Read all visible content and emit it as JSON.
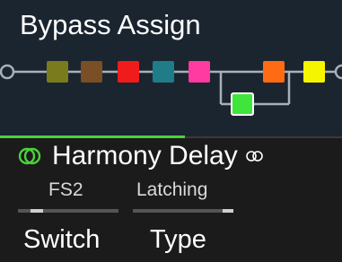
{
  "header": {
    "title": "Bypass Assign"
  },
  "signal_chain": {
    "blocks": [
      {
        "name": "block-1",
        "color": "#7a7b1c"
      },
      {
        "name": "block-2",
        "color": "#7a4f26"
      },
      {
        "name": "block-3",
        "color": "#f01b1b"
      },
      {
        "name": "block-4",
        "color": "#1f7d89"
      },
      {
        "name": "block-5",
        "color": "#ff3aa0"
      },
      {
        "name": "block-6",
        "color": "#ff6a14"
      },
      {
        "name": "block-7",
        "color": "#f5f500"
      },
      {
        "name": "block-8-parallel",
        "color": "#3fe53a"
      }
    ],
    "line_color": "#a8b0b8"
  },
  "selected_block": {
    "name": "Harmony Delay",
    "icon": "dual-circle-icon",
    "icon_color": "#4ad23c",
    "stereo_icon": "stereo-link-icon"
  },
  "parameters": [
    {
      "value": "FS2",
      "label": "Switch"
    },
    {
      "value": "Latching",
      "label": "Type"
    }
  ]
}
